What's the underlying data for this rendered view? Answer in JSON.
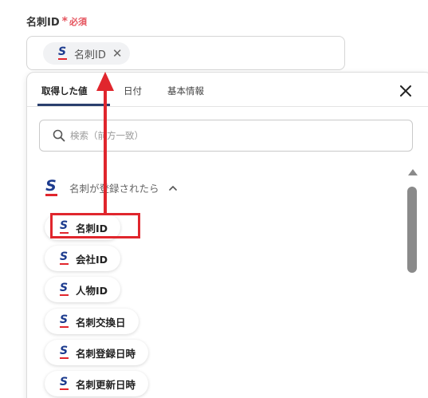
{
  "field": {
    "label": "名刺ID",
    "required_star": "*",
    "required_text": "必須",
    "chip_label": "名刺ID",
    "chip_remove": "✕"
  },
  "panel": {
    "tabs": [
      "取得した値",
      "日付",
      "基本情報"
    ],
    "active_tab": "取得した値",
    "search_placeholder": "検索（前方一致）",
    "group_label": "名刺が登録されたら",
    "items": [
      "名刺ID",
      "会社ID",
      "人物ID",
      "名刺交換日",
      "名刺登録日時",
      "名刺更新日時"
    ],
    "highlighted_item": "名刺ID"
  },
  "icons": {
    "app_logo": "sansan-s-logo",
    "close": "close-icon",
    "search": "search-icon",
    "collapse": "chevron-up-icon",
    "scroll_up": "triangle-up-icon"
  },
  "colors": {
    "required": "#e5535d",
    "annotation": "#e0262d",
    "logo_blue": "#1c3b8e",
    "logo_red": "#e1262d",
    "tab_underline": "#2a3f6e"
  }
}
